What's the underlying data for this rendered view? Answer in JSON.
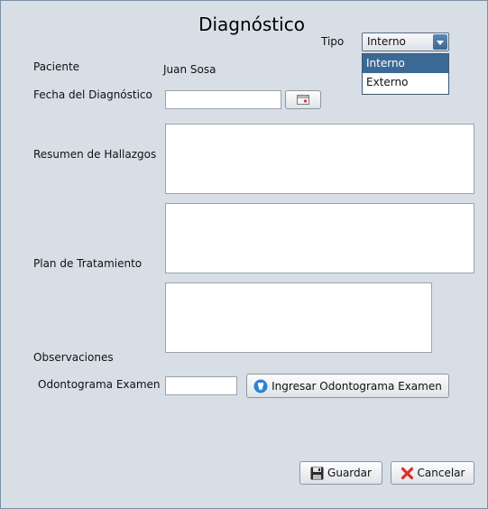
{
  "title": "Diagnóstico",
  "tipo": {
    "label": "Tipo",
    "selected": "Interno",
    "options": [
      "Interno",
      "Externo"
    ]
  },
  "paciente": {
    "label": "Paciente",
    "value": "Juan Sosa"
  },
  "fecha": {
    "label": "Fecha del Diagnóstico",
    "value": "",
    "calendar_icon": "calendar-icon"
  },
  "resumen": {
    "label": "Resumen de Hallazgos",
    "value": ""
  },
  "plan": {
    "label": "Plan de Tratamiento",
    "value": ""
  },
  "observaciones": {
    "label": "Observaciones",
    "value": ""
  },
  "odontograma": {
    "label": "Odontograma Examen",
    "value": "",
    "button_label": "Ingresar Odontograma Examen",
    "button_icon": "tooth-icon"
  },
  "actions": {
    "save_label": "Guardar",
    "save_icon": "floppy-disk-icon",
    "cancel_label": "Cancelar",
    "cancel_icon": "red-x-icon"
  },
  "colors": {
    "background": "#d8dee6",
    "accent": "#3c6a96",
    "cancel_red": "#d93030"
  }
}
